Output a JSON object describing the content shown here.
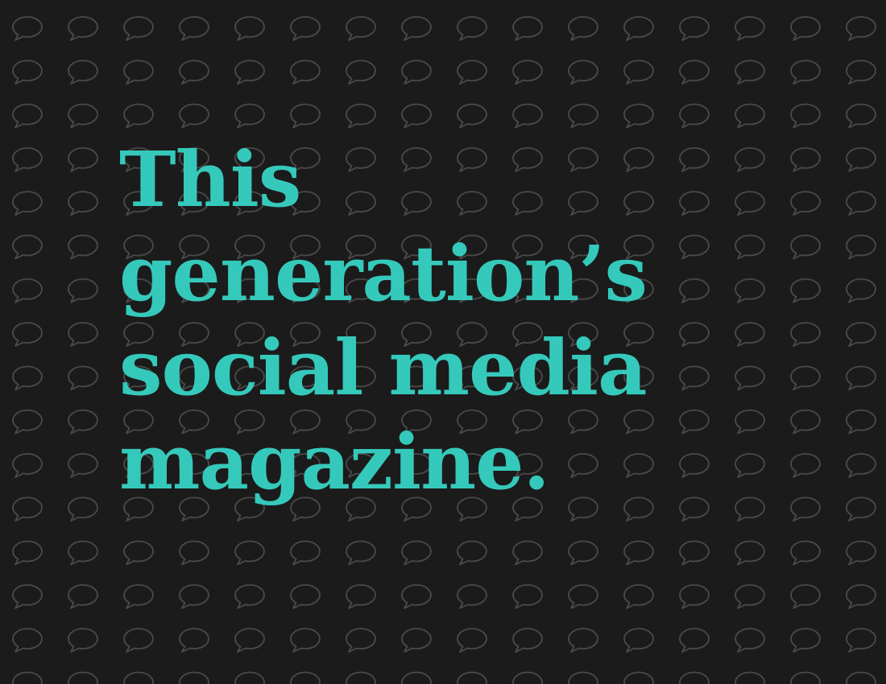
{
  "hero": {
    "headline_lines": [
      "This",
      "generation’s",
      "social media",
      "magazine."
    ]
  },
  "background": {
    "color": "#1b1b1b",
    "pattern_icon": "speech-bubble-icon",
    "pattern_stroke": "#4a4a4a"
  },
  "colors": {
    "accent": "#35c9bb"
  }
}
